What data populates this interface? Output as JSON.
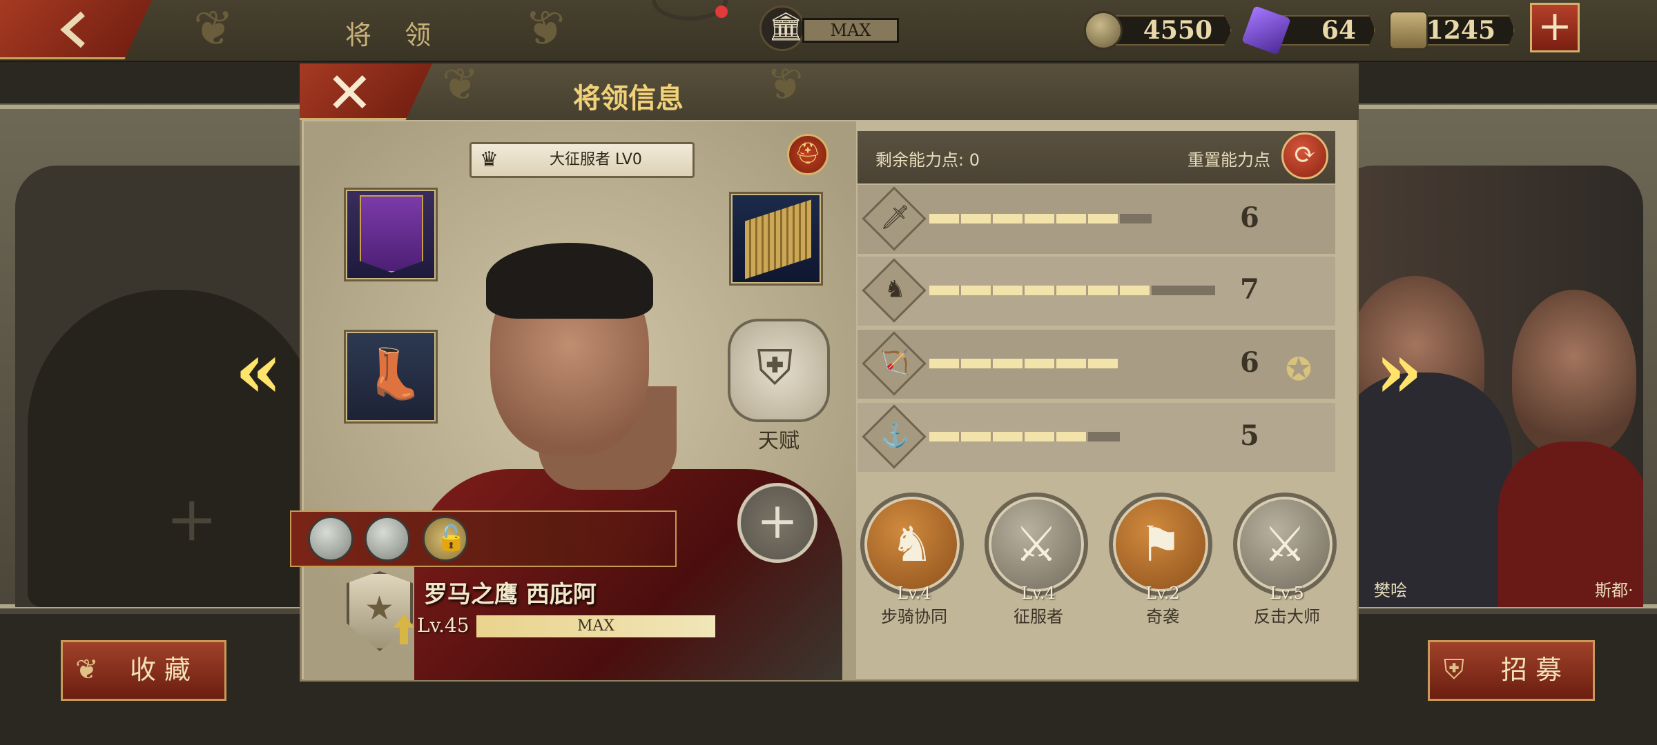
{
  "topbar": {
    "title": "将 领",
    "max_label": "MAX",
    "coins": "4550",
    "gems": "64",
    "tokens": "1245"
  },
  "modal": {
    "title": "将领信息",
    "rank_title": "大征服者 LV0",
    "talent_label": "天赋",
    "hero_name": "罗马之鹰 西庇阿",
    "hero_level": "Lv.45",
    "hero_level_bar": "MAX"
  },
  "stats": {
    "remaining_label": "剩余能力点: 0",
    "reset_label": "重置能力点",
    "rows": [
      {
        "icon": "sword-icon",
        "glyph": "🗡",
        "value": "6",
        "filled": 6,
        "total": 7
      },
      {
        "icon": "horse-icon",
        "glyph": "♞",
        "value": "7",
        "filled": 7,
        "total": 9
      },
      {
        "icon": "bow-icon",
        "glyph": "🏹",
        "value": "6",
        "filled": 6,
        "total": 6
      },
      {
        "icon": "anchor-icon",
        "glyph": "⚓",
        "value": "5",
        "filled": 5,
        "total": 6
      }
    ]
  },
  "skills": [
    {
      "level": "Lv.4",
      "name": "步骑协同",
      "style": "bronze"
    },
    {
      "level": "Lv.4",
      "name": "征服者",
      "style": "silver"
    },
    {
      "level": "Lv.2",
      "name": "奇袭",
      "style": "bronze"
    },
    {
      "level": "Lv.5",
      "name": "反击大师",
      "style": "silver"
    }
  ],
  "side_heroes": {
    "left_name": "樊哙",
    "right_name": "斯都·"
  },
  "buttons": {
    "collect": "收藏",
    "recruit": "招募"
  },
  "colors": {
    "accent_red": "#8a2412",
    "gold_text": "#f1d27a",
    "bar_fill": "#f1e3a9"
  }
}
